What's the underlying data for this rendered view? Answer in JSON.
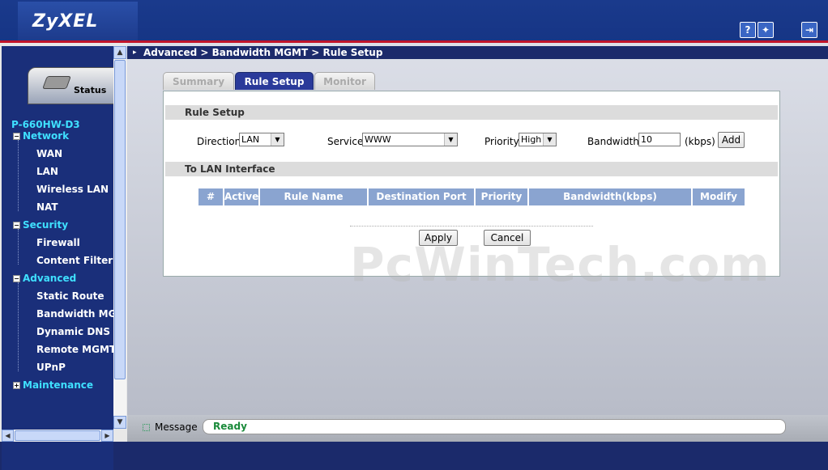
{
  "brand": {
    "logo": "ZyXEL"
  },
  "header": {
    "icons": [
      "help-icon",
      "wizard-icon",
      "logout-icon"
    ]
  },
  "sidebar": {
    "status_tab": "Status",
    "model": "P-660HW-D3",
    "items": [
      {
        "label": "Network",
        "type": "category"
      },
      {
        "label": "WAN",
        "type": "item"
      },
      {
        "label": "LAN",
        "type": "item"
      },
      {
        "label": "Wireless LAN",
        "type": "item"
      },
      {
        "label": "NAT",
        "type": "item"
      },
      {
        "label": "Security",
        "type": "category"
      },
      {
        "label": "Firewall",
        "type": "item"
      },
      {
        "label": "Content Filter",
        "type": "item"
      },
      {
        "label": "Advanced",
        "type": "category"
      },
      {
        "label": "Static Route",
        "type": "item"
      },
      {
        "label": "Bandwidth MGMT",
        "type": "item"
      },
      {
        "label": "Dynamic DNS",
        "type": "item"
      },
      {
        "label": "Remote MGMT",
        "type": "item"
      },
      {
        "label": "UPnP",
        "type": "item"
      },
      {
        "label": "Maintenance",
        "type": "category"
      }
    ]
  },
  "breadcrumb": "Advanced > Bandwidth MGMT > Rule Setup",
  "tabs": [
    {
      "label": "Summary",
      "active": false
    },
    {
      "label": "Rule Setup",
      "active": true
    },
    {
      "label": "Monitor",
      "active": false
    }
  ],
  "rule_setup": {
    "heading": "Rule Setup",
    "direction_label": "Direction",
    "direction_value": "LAN",
    "service_label": "Service",
    "service_value": "WWW",
    "priority_label": "Priority",
    "priority_value": "High",
    "bandwidth_label": "Bandwidth",
    "bandwidth_value": "10",
    "bandwidth_unit": "(kbps)",
    "add_button": "Add"
  },
  "interface": {
    "heading": "To LAN Interface",
    "columns": [
      "#",
      "Active",
      "Rule Name",
      "Destination Port",
      "Priority",
      "Bandwidth(kbps)",
      "Modify"
    ]
  },
  "actions": {
    "apply": "Apply",
    "cancel": "Cancel"
  },
  "watermark": "PcWinTech.com",
  "statusbar": {
    "label": "Message",
    "value": "Ready"
  },
  "colors": {
    "header": "#1a3a8c",
    "accent_red": "#c0142a",
    "nav_category": "#3fe0ff",
    "table_header": "#8aa4d0",
    "ready_text": "#1a8a3a"
  }
}
